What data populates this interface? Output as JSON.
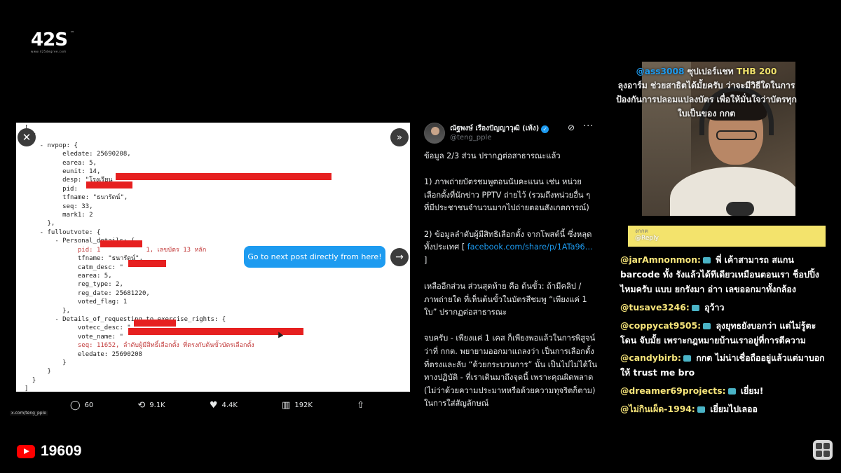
{
  "logo": {
    "text": "42",
    "text2": "S",
    "sup": "™",
    "sub": "www.425degree.com"
  },
  "media": {
    "code_lines": [
      "[",
      "  {",
      "    - nvpop: {",
      "          eledate: 25690208,",
      "          earea: 5,",
      "          eunit: 14,",
      "          desp: \"โรงเรียน",
      "          pid: ",
      "          tfname: \"ธนารัตน์\",",
      "          seq: 33,",
      "          mark1: 2",
      "      },",
      "    - fulloutvote: {",
      "        - Personal_details: {",
      "              pid: 1            1, เลขบัตร 13 หลัก",
      "              tfname: \"ธนารัตน์\",",
      "              catm_desc: \"",
      "              earea: 5,",
      "              reg_type: 2,",
      "              reg_date: 25681220,",
      "              voted_flag: 1",
      "          },",
      "        - Details_of_requesting_to_exercise_rights: {",
      "              votecc_desc: \"",
      "              vote_name: \"",
      "              seq: 11652, ลำดับผู้มีสิทธิ์เลือกตั้ง ที่ตรงกับต้นขั้วบัตรเลือกตั้ง",
      "              eledate: 25690208",
      "          }",
      "      }",
      "  }",
      "]"
    ],
    "tooltip": "Go to next post directly from here!",
    "caption_url": "x.com/teng_pple"
  },
  "actions": {
    "replies": "60",
    "reposts": "9.1K",
    "likes": "4.4K",
    "views": "192K"
  },
  "tweet": {
    "author": "ณัฐพงษ์ เรืองปัญญาวุฒิ (เท้ง)",
    "handle": "@teng_pple",
    "p1": "ข้อมูล 2/3 ส่วน ปรากฏต่อสาธารณะแล้ว",
    "p2": "1) ภาพถ่ายบัตรชมพูตอนนับคะแนน เช่น หน่วยเลือกตั้งที่นักข่าว PPTV ถ่ายไว้ (รวมถึงหน่วยอื่น ๆ ที่มีประชาชนจำนวนมากไปถ่ายตอนสังเกตการณ์)",
    "p3a": "2) ข้อมูลลำดับผู้มีสิทธิเลือกตั้ง จากโพสต์นี้ ซึ่งหลุดทั้งประเทศ [ ",
    "p3link": "facebook.com/share/p/1ATa96…",
    "p3b": " ]",
    "p4": "เหลืออีกส่วน ส่วนสุดท้าย คือ ต้นขั้ว: ถ้ามีคลิป / ภาพถ่ายใด ที่เห็นต้นขั้วในบัตรสีชมพู “เพียงแค่ 1 ใบ” ปรากฏต่อสาธารณะ",
    "p5": "จบครับ - เพียงแค่ 1 เคส ก็เพียงพอแล้วในการพิสูจน์ ว่าที่ กกต. พยายามออกมาแถลงว่า เป็นการเลือกตั้งที่ตรงและลับ “ด้วยกระบวนการ” นั้น เป็นไปไม่ได้ในทางปฏิบัติ - ที่เราเดินมาถึงจุดนี้ เพราะคุณผิดพลาด (ไม่ว่าด้วยความประมาทหรือด้วยความทุจริตก็ตาม) ในการใส่สัญลักษณ์"
  },
  "donation": {
    "user": "@ass",
    "user_tail": "3008",
    "label": " ซุปเปอร์แชท ",
    "amount": "THB 200",
    "line2": "ลุงอาร์ม ช่วยสาธิตได้มั้ยครับ ว่าจะมีวิธีใดในการ",
    "line3": "ป้องกันการปลอมแปลงบัตร เพื่อให้มั่นใจว่าบัตรทุก",
    "line4": "ใบเป็นของ กกต"
  },
  "chat": {
    "reply_prev": "งกกต",
    "reply_label": "@Reply",
    "messages": [
      {
        "user": "@jarAmnonmon:",
        "text": " พี่ เค้าสามารถ สแกน barcode ทั้ง รังแล้วได้ทีเดียวเหมือนตอนเรา ช็อปปิ้งไหมครับ แบบ ยกรังมา อ่าา เลขออกมาทั้งกล้อง"
      },
      {
        "user": "@tusave3246:",
        "text": " อุว้าว"
      },
      {
        "user": "@coppycat9505:",
        "text": " ลุงยุทธยังบอกว่า แต่ไม่รู้ตะโดน จับมั้ย เพราะกฎหมายบ้านเราอยู่ที่การตีความ"
      },
      {
        "user": "@candybirb:",
        "text": " กกต ไม่น่าเชื่อถืออยู่แล้วแต่มาบอกให้ trust me bro"
      },
      {
        "user": "@dreamer69projects:",
        "text": " เยี่ยม!"
      },
      {
        "user": "@ไม่กินเผ็ด-1994:",
        "text": " เยี่ยมไปเลออ"
      }
    ]
  },
  "footer": {
    "subscriber_count": "19609"
  }
}
